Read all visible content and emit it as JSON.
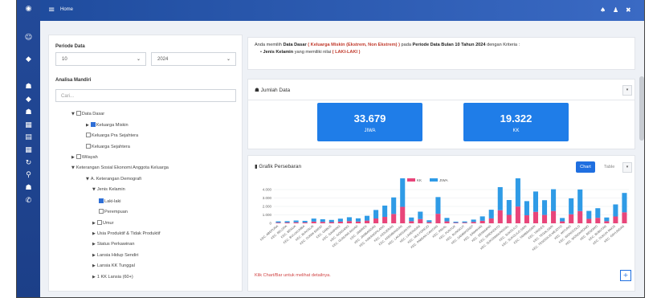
{
  "topbar": {
    "menu_icon": "hamburger-icon",
    "home_label": "Home"
  },
  "filters": {
    "periode_label": "Periode Data",
    "month_value": "10",
    "year_value": "2024",
    "analisa_label": "Analisa Mandiri",
    "search_placeholder": "Cari..."
  },
  "tree": [
    {
      "text": "Data Dasar",
      "indent": 0,
      "arrow": "▼",
      "checkbox": "off"
    },
    {
      "text": "Keluarga Miskin",
      "indent": 1,
      "arrow": "▶",
      "checkbox": "on"
    },
    {
      "text": "Keluarga Pra Sejahtera",
      "indent": 1,
      "arrow": "",
      "checkbox": "off"
    },
    {
      "text": "Keluarga Sejahtera",
      "indent": 1,
      "arrow": "",
      "checkbox": "off"
    },
    {
      "text": "Wilayah",
      "indent": 0,
      "arrow": "▶",
      "checkbox": "off"
    },
    {
      "text": "Keterangan Sosial Ekonomi Anggota Keluarga",
      "indent": 0,
      "arrow": "▼",
      "checkbox": "none"
    },
    {
      "text": "A. Keterangan Demografi",
      "indent": 1,
      "arrow": "▼",
      "checkbox": "none"
    },
    {
      "text": "Jenis Kelamin",
      "indent": 2,
      "arrow": "▼",
      "checkbox": "none"
    },
    {
      "text": "Laki-laki",
      "indent": 3,
      "arrow": "",
      "checkbox": "on"
    },
    {
      "text": "Perempuan",
      "indent": 3,
      "arrow": "",
      "checkbox": "off"
    },
    {
      "text": "Umur",
      "indent": 2,
      "arrow": "▶",
      "checkbox": "off"
    },
    {
      "text": "Usia Produktif & Tidak Produktif",
      "indent": 2,
      "arrow": "▶",
      "checkbox": "none"
    },
    {
      "text": "Status Perkawinan",
      "indent": 2,
      "arrow": "▶",
      "checkbox": "none"
    },
    {
      "text": "Lansia Hidup Sendiri",
      "indent": 2,
      "arrow": "▶",
      "checkbox": "none"
    },
    {
      "text": "Lansia KK Tunggal",
      "indent": 2,
      "arrow": "▶",
      "checkbox": "none"
    },
    {
      "text": "1 KK Lansia (60+)",
      "indent": 2,
      "arrow": "▶",
      "checkbox": "none"
    }
  ],
  "info": {
    "prefix": "Anda memilih",
    "data_dasar": "Data Dasar",
    "kategori": "( Keluarga Miskin (Ekstrem, Non Ekstrem) )",
    "mid": "pada",
    "periode": "Periode Data Bulan 10 Tahun 2024",
    "suffix": "dengan Kriteria :",
    "kriteria_label": "Jenis Kelamin",
    "kriteria_mid": "yang memiliki nilai",
    "kriteria_value": "( LAKI-LAKI )"
  },
  "jumlah": {
    "title": "Jumlah Data",
    "stats": [
      {
        "value": "33.679",
        "unit": "JIWA"
      },
      {
        "value": "19.322",
        "unit": "KK"
      }
    ]
  },
  "grafik": {
    "title": "Grafik Persebaran",
    "chart_button": "Chart",
    "table_button": "Table",
    "note": "Klik Chart/Bar untuk melihat detailnya."
  },
  "chart_data": {
    "type": "bar",
    "yticks": [
      "4.000",
      "3.000",
      "2.000",
      "1.000",
      "0"
    ],
    "ylim": [
      0,
      4000
    ],
    "series": [
      {
        "name": "KK",
        "color": "#e8457a",
        "values": [
          80,
          90,
          120,
          100,
          200,
          170,
          140,
          200,
          260,
          210,
          320,
          570,
          760,
          1110,
          1950,
          250,
          500,
          130,
          1130,
          230,
          70,
          80,
          160,
          300,
          580,
          1550,
          1000,
          1990,
          950,
          1360,
          990,
          1460,
          230,
          1070,
          1450,
          530,
          650,
          250,
          810,
          1300
        ]
      },
      {
        "name": "JIWA",
        "color": "#2f9be6",
        "values": [
          150,
          160,
          210,
          190,
          360,
          310,
          260,
          350,
          460,
          380,
          570,
          1010,
          1340,
          1960,
          3440,
          440,
          880,
          230,
          1980,
          410,
          120,
          140,
          280,
          520,
          1030,
          2740,
          1760,
          3510,
          1680,
          2410,
          1750,
          2580,
          400,
          1890,
          2560,
          940,
          1140,
          440,
          1430,
          2300
        ]
      }
    ],
    "categories": [
      "KEC. ABEPURA",
      "KEC. BELOPA",
      "KEC. BENUA",
      "KEC. BULUKUMBA",
      "KEC. BUNTALAI",
      "KEC. DUMAI BARAT",
      "KEC. GABUS",
      "KEC. GAMPING",
      "KEC. GONDANG",
      "KEC. GUNUNG ANYAR",
      "KEC. JABIREN",
      "KEC. JAMBANGAN",
      "KEC. KARANGPILANG",
      "KEC. KENJERAN",
      "KEC. KREMBANGAN",
      "KEC. LAKARSANTRI",
      "KEC. LAMONGAN",
      "KEC. MULYOREJO",
      "KEC. PABEAN CANTIAN",
      "KEC. PAKAL",
      "KEC. PUNTUK",
      "KEC. RUNGKUT",
      "KEC. SAMBIKEREP",
      "KEC. SAWAHAN",
      "KEC. SEMAMPIR",
      "KEC. SIMOKERTO",
      "KEC. SUKOMANUNGGAL",
      "KEC. SUKOLILO",
      "KEC. SUKOLILO SARI",
      "KEC. TAMBAKSARI",
      "KEC. TANDES",
      "KEC. TEGALSARI",
      "KEC. TENGGILIS MEJOYO",
      "KEC. WIYUNG",
      "KEC. WONOCOLO",
      "KEC. WONOKROMO",
      "KEC. BENOWO",
      "KEC. BUBUTAN",
      "KEC. DUKUH PAKIS",
      "KEC. GAYUNGAN"
    ]
  }
}
